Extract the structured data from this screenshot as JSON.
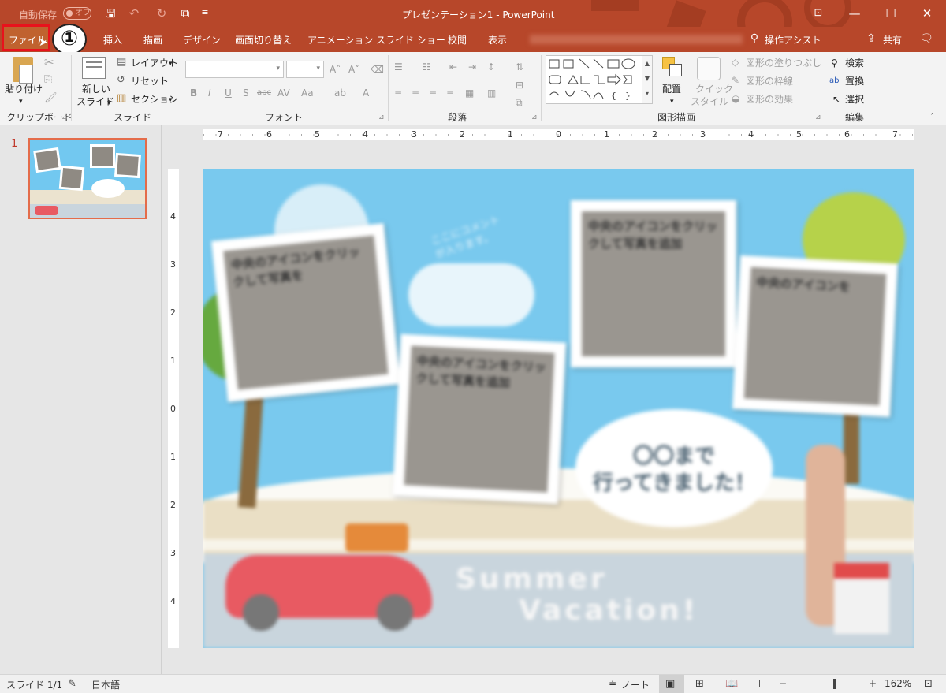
{
  "titlebar": {
    "autosave_label": "自動保存",
    "autosave_state": "オフ",
    "doc_title": "プレゼンテーション1 - PowerPoint"
  },
  "tabs": {
    "file": "ファイル",
    "marker": "①",
    "items": [
      "挿入",
      "描画",
      "デザイン",
      "画面切り替え",
      "アニメーション",
      "スライド ショー",
      "校閲",
      "表示"
    ],
    "tell_me": "操作アシスト",
    "share": "共有"
  },
  "ribbon": {
    "clipboard": {
      "paste": "貼り付け",
      "label": "クリップボード"
    },
    "slides": {
      "new_slide_1": "新しい",
      "new_slide_2": "スライド",
      "layout": "レイアウト",
      "reset": "リセット",
      "section": "セクション",
      "label": "スライド"
    },
    "font": {
      "label": "フォント"
    },
    "paragraph": {
      "label": "段落"
    },
    "drawing": {
      "arrange": "配置",
      "quick_style_1": "クイック",
      "quick_style_2": "スタイル",
      "fill": "図形の塗りつぶし",
      "outline": "図形の枠線",
      "effects": "図形の効果",
      "label": "図形描画"
    },
    "editing": {
      "find": "検索",
      "replace": "置換",
      "select": "選択",
      "label": "編集"
    }
  },
  "slide_panel": {
    "slide_number": "1"
  },
  "ruler": {
    "h": [
      "7",
      "6",
      "5",
      "4",
      "3",
      "2",
      "1",
      "0",
      "1",
      "2",
      "3",
      "4",
      "5",
      "6",
      "7"
    ],
    "v": [
      "4",
      "3",
      "2",
      "1",
      "0",
      "1",
      "2",
      "3",
      "4"
    ]
  },
  "slide": {
    "comment_1": "ここにコメント",
    "comment_2": "が入ります。",
    "photo1_text": "中央のアイコンをクリックして写真を",
    "photo2_text": "中央のアイコンをクリックして写真を追加",
    "photo3_text": "中央のアイコンをクリックして写真を追加",
    "photo4_text": "中央のアイコンを",
    "bubble_1": "〇〇まで",
    "bubble_2": "行ってきました！",
    "summer": "Summer",
    "vacation": "Vacation!"
  },
  "statusbar": {
    "slide_info": "スライド 1/1",
    "language": "日本語",
    "notes": "ノート",
    "zoom": "162%"
  },
  "colors": {
    "accent": "#b7472a",
    "file_highlight": "#e8121c"
  }
}
